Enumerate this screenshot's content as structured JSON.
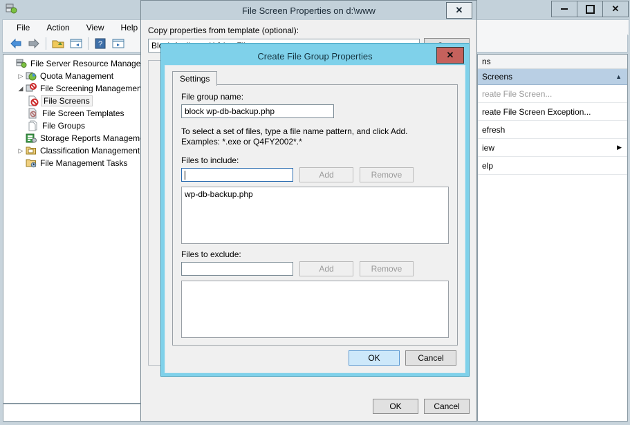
{
  "window": {
    "app_icon": "server-manager-icon",
    "minimize": "–",
    "maximize": "□",
    "close": "✕"
  },
  "menubar": {
    "items": [
      {
        "label": "File"
      },
      {
        "label": "Action"
      },
      {
        "label": "View"
      },
      {
        "label": "Help"
      }
    ]
  },
  "toolbar": {
    "buttons": [
      {
        "name": "back-icon"
      },
      {
        "name": "forward-icon"
      },
      {
        "name": "up-folder-icon"
      },
      {
        "name": "show-hide-console-tree-icon"
      },
      {
        "name": "help-icon"
      },
      {
        "name": "show-hide-action-pane-icon"
      }
    ]
  },
  "tree": {
    "items": [
      {
        "label": "File Server Resource Manager (Lo",
        "icon": "server-icon",
        "twisty": "",
        "indent": 1,
        "selected": false
      },
      {
        "label": "Quota Management",
        "icon": "quota-icon",
        "twisty": "▷",
        "indent": 2,
        "selected": false
      },
      {
        "label": "File Screening Management",
        "icon": "file-screen-icon",
        "twisty": "◢",
        "indent": 2,
        "selected": false
      },
      {
        "label": "File Screens",
        "icon": "file-screens-icon",
        "twisty": "",
        "indent": 3,
        "selected": true
      },
      {
        "label": "File Screen Templates",
        "icon": "file-screen-templates-icon",
        "twisty": "",
        "indent": 3,
        "selected": false
      },
      {
        "label": "File Groups",
        "icon": "file-groups-icon",
        "twisty": "",
        "indent": 3,
        "selected": false
      },
      {
        "label": "Storage Reports Management",
        "icon": "storage-reports-icon",
        "twisty": "",
        "indent": 2,
        "selected": false
      },
      {
        "label": "Classification Management",
        "icon": "classification-icon",
        "twisty": "▷",
        "indent": 2,
        "selected": false
      },
      {
        "label": "File Management Tasks",
        "icon": "file-management-tasks-icon",
        "twisty": "",
        "indent": 2,
        "selected": false
      }
    ]
  },
  "actions_pane": {
    "header": "ns",
    "group_title": "Screens",
    "collapse_caret": "▲",
    "items": [
      {
        "label": "reate File Screen...",
        "disabled": true,
        "submenu": ""
      },
      {
        "label": "reate File Screen Exception...",
        "disabled": false,
        "submenu": ""
      },
      {
        "label": "efresh",
        "disabled": false,
        "submenu": ""
      },
      {
        "label": "iew",
        "disabled": false,
        "submenu": "▶"
      },
      {
        "label": "elp",
        "disabled": false,
        "submenu": ""
      }
    ]
  },
  "outer_dialog": {
    "title": "File Screen Properties on d:\\www",
    "close_label": "✕",
    "template_label": "Copy properties from template (optional):",
    "template_value": "Block Audio and Video Files",
    "template_arrow": "∨",
    "copy_button": "Copy",
    "ok_button": "OK",
    "cancel_button": "Cancel"
  },
  "inner_dialog": {
    "title": "Create File Group Properties",
    "close_label": "✕",
    "tab_label": "Settings",
    "file_group_name_label": "File group name:",
    "file_group_name_value": "block wp-db-backup.php",
    "hint_line1": "To select a set of files, type a file name pattern, and click Add.",
    "hint_line2": "Examples: *.exe or Q4FY2002*.*",
    "include_label": "Files to include:",
    "include_value": "",
    "include_add": "Add",
    "include_remove": "Remove",
    "include_list": [
      "wp-db-backup.php"
    ],
    "exclude_label": "Files to exclude:",
    "exclude_value": "",
    "exclude_add": "Add",
    "exclude_remove": "Remove",
    "exclude_list": [],
    "ok_button": "OK",
    "cancel_button": "Cancel"
  },
  "colors": {
    "window_chrome": "#c3d1da",
    "inner_dialog_accent": "#7fd1ea",
    "inner_close_red": "#c5615c",
    "actions_group_blue": "#b9cfe4",
    "focus_button_blue": "#cde8fa"
  }
}
